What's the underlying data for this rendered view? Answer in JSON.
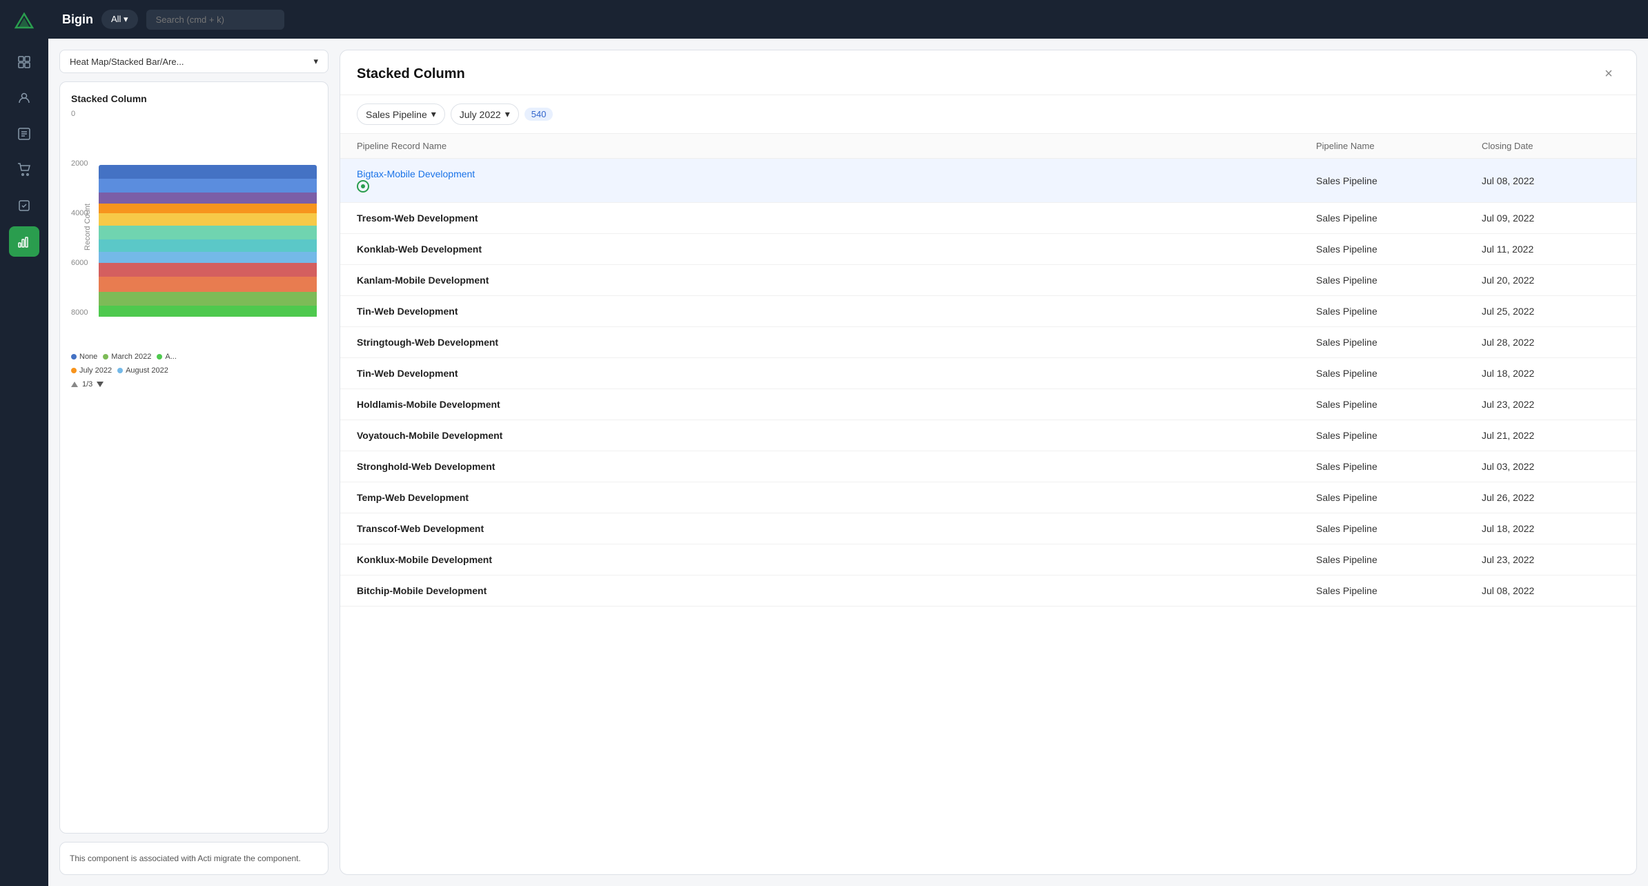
{
  "app": {
    "name": "Bigin",
    "search_placeholder": "Search (cmd + k)"
  },
  "sidebar": {
    "items": [
      {
        "name": "logo",
        "icon": "▽"
      },
      {
        "name": "dashboard",
        "icon": "⊞"
      },
      {
        "name": "contacts",
        "icon": "👤"
      },
      {
        "name": "list",
        "icon": "☰"
      },
      {
        "name": "cart",
        "icon": "🛒"
      },
      {
        "name": "calendar",
        "icon": "✓"
      },
      {
        "name": "analytics",
        "icon": "📊",
        "active": true
      }
    ]
  },
  "left_panel": {
    "chart_type_selector": "Heat Map/Stacked Bar/Are...",
    "chart": {
      "title": "Stacked Column",
      "y_axis_title": "Record Count",
      "y_labels": [
        "8000",
        "6000",
        "4000",
        "2000",
        "0"
      ],
      "legend": {
        "items": [
          {
            "label": "None",
            "color": "#4472c4"
          },
          {
            "label": "March 2022",
            "color": "#7dbb57"
          },
          {
            "label": "July 2022",
            "color": "#f7941d"
          },
          {
            "label": "August 2022",
            "color": "#9dc3e6"
          }
        ],
        "nav": "1/3"
      }
    },
    "info_text": "This component is associated with Acti migrate the component."
  },
  "modal": {
    "title": "Stacked Column",
    "close_label": "×",
    "filter1_label": "Sales Pipeline",
    "filter2_label": "July 2022",
    "count_badge": "540",
    "table": {
      "headers": [
        "Pipeline Record Name",
        "Pipeline Name",
        "Closing Date"
      ],
      "rows": [
        {
          "record": "Bigtax-Mobile Development",
          "pipeline": "Sales Pipeline",
          "date": "Jul 08, 2022",
          "link": true,
          "highlighted": true
        },
        {
          "record": "Tresom-Web Development",
          "pipeline": "Sales Pipeline",
          "date": "Jul 09, 2022",
          "link": false
        },
        {
          "record": "Konklab-Web Development",
          "pipeline": "Sales Pipeline",
          "date": "Jul 11, 2022",
          "link": false
        },
        {
          "record": "Kanlam-Mobile Development",
          "pipeline": "Sales Pipeline",
          "date": "Jul 20, 2022",
          "link": false
        },
        {
          "record": "Tin-Web Development",
          "pipeline": "Sales Pipeline",
          "date": "Jul 25, 2022",
          "link": false
        },
        {
          "record": "Stringtough-Web Development",
          "pipeline": "Sales Pipeline",
          "date": "Jul 28, 2022",
          "link": false
        },
        {
          "record": "Tin-Web Development",
          "pipeline": "Sales Pipeline",
          "date": "Jul 18, 2022",
          "link": false
        },
        {
          "record": "Holdlamis-Mobile Development",
          "pipeline": "Sales Pipeline",
          "date": "Jul 23, 2022",
          "link": false
        },
        {
          "record": "Voyatouch-Mobile Development",
          "pipeline": "Sales Pipeline",
          "date": "Jul 21, 2022",
          "link": false
        },
        {
          "record": "Stronghold-Web Development",
          "pipeline": "Sales Pipeline",
          "date": "Jul 03, 2022",
          "link": false
        },
        {
          "record": "Temp-Web Development",
          "pipeline": "Sales Pipeline",
          "date": "Jul 26, 2022",
          "link": false
        },
        {
          "record": "Transcof-Web Development",
          "pipeline": "Sales Pipeline",
          "date": "Jul 18, 2022",
          "link": false
        },
        {
          "record": "Konklux-Mobile Development",
          "pipeline": "Sales Pipeline",
          "date": "Jul 23, 2022",
          "link": false
        },
        {
          "record": "Bitchip-Mobile Development",
          "pipeline": "Sales Pipeline",
          "date": "Jul 08, 2022",
          "link": false
        }
      ]
    }
  },
  "chart_bars": [
    {
      "segments": [
        {
          "color": "#5b8dde",
          "height": 12
        },
        {
          "color": "#4e6fa8",
          "height": 10
        },
        {
          "color": "#7b5ea7",
          "height": 8
        },
        {
          "color": "#f7941d",
          "height": 7
        },
        {
          "color": "#f7c948",
          "height": 9
        },
        {
          "color": "#70d4b0",
          "height": 10
        },
        {
          "color": "#5bc8c8",
          "height": 9
        },
        {
          "color": "#74b9e8",
          "height": 8
        },
        {
          "color": "#d45f5f",
          "height": 10
        },
        {
          "color": "#e87c50",
          "height": 11
        },
        {
          "color": "#7dbb57",
          "height": 10
        },
        {
          "color": "#4ec94e",
          "height": 8
        }
      ],
      "total_pct": 85
    }
  ]
}
